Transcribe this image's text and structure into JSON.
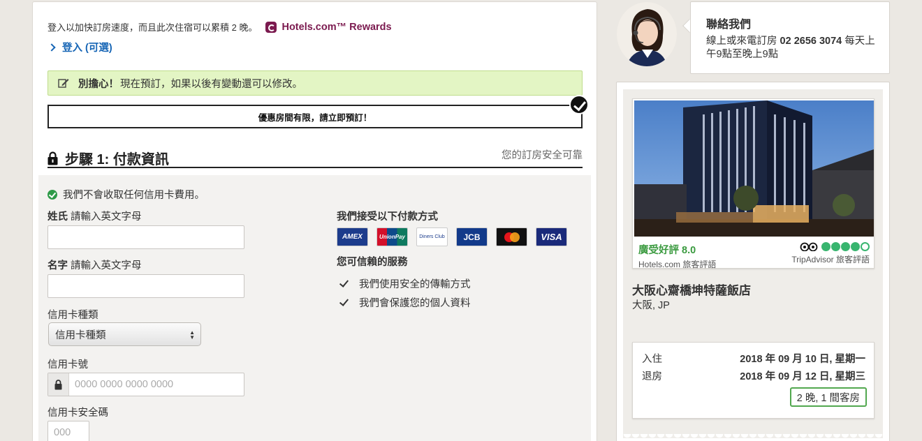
{
  "signin": {
    "prompt": "登入以加快訂房速度，而且此次住宿可以累積 2 晚。",
    "rewards_label": "Hotels.com™ Rewards",
    "link_label": "登入 (可選)"
  },
  "notice": {
    "bold": "別擔心！",
    "text": "現在預訂，如果以後有變動還可以修改。"
  },
  "urgency": {
    "text": "優惠房間有限，請立即預訂！"
  },
  "step": {
    "title": "步驟 1: 付款資訊",
    "secure_text": "您的訂房安全可靠"
  },
  "form": {
    "no_charge": "我們不會收取任何信用卡費用。",
    "surname_label": "姓氏",
    "surname_hint": "請輸入英文字母",
    "surname_value": "",
    "given_label": "名字",
    "given_hint": "請輸入英文字母",
    "given_value": "",
    "card_type_label": "信用卡種類",
    "card_type_selected": "信用卡種類",
    "card_number_label": "信用卡號",
    "card_number_placeholder": "0000 0000 0000 0000",
    "cvv_label": "信用卡安全碼",
    "cvv_placeholder": "000"
  },
  "payment": {
    "heading": "我們接受以下付款方式",
    "cards": [
      {
        "name": "AMEX",
        "color": "#1c3c8c"
      },
      {
        "name": "UnionPay 銀聯",
        "color": "#d3102a"
      },
      {
        "name": "Diners Club",
        "color": "#ffffff"
      },
      {
        "name": "JCB",
        "color": "#123a8a"
      },
      {
        "name": "mastercard",
        "color": "#111111"
      },
      {
        "name": "VISA",
        "color": "#1a2a7a"
      }
    ],
    "trust_heading": "您可信賴的服務",
    "trust_items": [
      "我們使用安全的傳輸方式",
      "我們會保護您的個人資料"
    ]
  },
  "contact": {
    "title": "聯絡我們",
    "line_prefix": "線上或來電訂房",
    "phone": "02 2656 3074",
    "line_suffix": "每天上午9點至晚上9點"
  },
  "hotel": {
    "rating_label": "廣受好評 8.0",
    "rating_source": "Hotels.com 旅客評語",
    "tripadvisor_bubbles": 4,
    "tripadvisor_source": "TripAdvisor 旅客評語",
    "name": "大阪心齋橋坤特薩飯店",
    "location": "大阪, JP",
    "checkin_label": "入住",
    "checkin_value": "2018 年 09 月 10 日, 星期一",
    "checkout_label": "退房",
    "checkout_value": "2018 年 09 月 12 日, 星期三",
    "nights_rooms": "2 晚, 1 間客房"
  },
  "colors": {
    "rewards": "#7b1a4f",
    "link": "#1665b5",
    "notice_bg": "#e3f5c4",
    "rating_green": "#3a9a3f",
    "tripadvisor_green": "#38b56f"
  }
}
